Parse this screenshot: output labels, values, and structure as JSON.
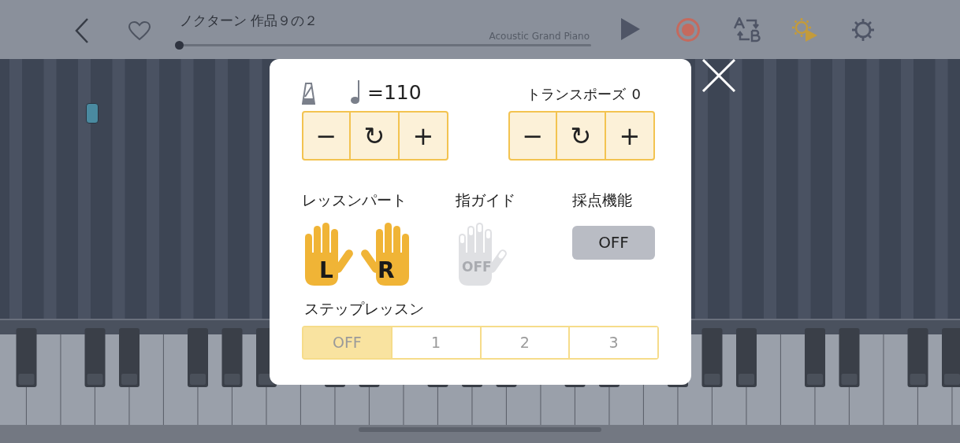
{
  "top_bar": {
    "title": "ノクターン 作品９の２",
    "instrument": "Acoustic Grand Piano",
    "progress": {
      "level": 0.0
    }
  },
  "tempo": {
    "value_text": "=110",
    "buttons": [
      "−",
      "↻",
      "+"
    ]
  },
  "transpose": {
    "label": "トランスポーズ",
    "value": "0",
    "buttons": [
      "−",
      "↻",
      "+"
    ]
  },
  "lesson_part": {
    "label": "レッスンパート",
    "hands": [
      {
        "kind": "left",
        "letter": "L",
        "on": true
      },
      {
        "kind": "right",
        "letter": "R",
        "on": true
      }
    ]
  },
  "finger_guide": {
    "label": "指ガイド",
    "on": false,
    "state_text": "OFF"
  },
  "scoring": {
    "label": "採点機能",
    "on": false,
    "toggle_text": "OFF"
  },
  "step_lesson": {
    "label": "ステップレッスン",
    "options": [
      {
        "label": "OFF",
        "selected": true
      },
      {
        "label": "1",
        "selected": false
      },
      {
        "label": "2",
        "selected": false
      },
      {
        "label": "3",
        "selected": false
      }
    ]
  }
}
